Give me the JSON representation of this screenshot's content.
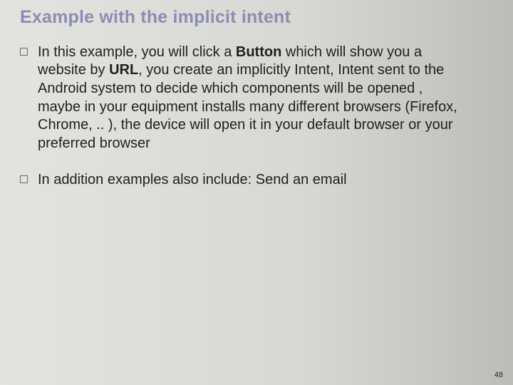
{
  "slide": {
    "title": "Example with the implicit intent",
    "bullets": [
      {
        "pre1": "In this example, you will click a ",
        "bold1": "Button",
        "mid1": " which will show you a website by ",
        "bold2": "URL",
        "post1": ", you create an implicitly Intent, Intent sent to the Android system to decide which  components will be opened , maybe in your equipment installs many different browsers (Firefox, Chrome, .. ), the device will open it in your default browser or your preferred browser"
      },
      {
        "text": "In addition examples also include: Send an email"
      }
    ],
    "page_number": "48"
  }
}
